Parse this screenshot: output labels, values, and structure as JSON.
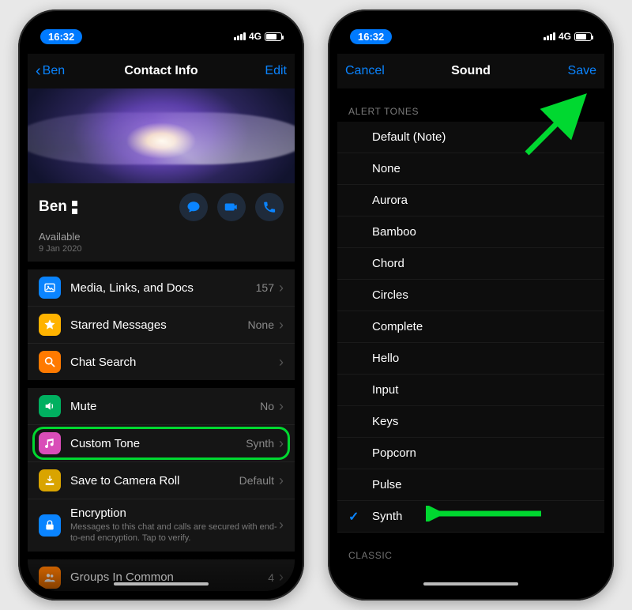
{
  "status": {
    "time": "16:32",
    "network": "4G"
  },
  "phone1": {
    "nav": {
      "back": "Ben",
      "title": "Contact Info",
      "edit": "Edit"
    },
    "contact": {
      "name": "Ben",
      "status": "Available",
      "date": "9 Jan 2020"
    },
    "group1": [
      {
        "id": "media",
        "icon": "photo-icon",
        "color": "i-blue",
        "label": "Media, Links, and Docs",
        "value": "157"
      },
      {
        "id": "starred",
        "icon": "star-icon",
        "color": "i-yellow",
        "label": "Starred Messages",
        "value": "None"
      },
      {
        "id": "search",
        "icon": "search-icon",
        "color": "i-orange",
        "label": "Chat Search",
        "value": ""
      }
    ],
    "group2": [
      {
        "id": "mute",
        "icon": "speaker-icon",
        "color": "i-green",
        "label": "Mute",
        "value": "No"
      },
      {
        "id": "tone",
        "icon": "music-icon",
        "color": "i-pink",
        "label": "Custom Tone",
        "value": "Synth",
        "highlight": true
      },
      {
        "id": "saveroll",
        "icon": "download-icon",
        "color": "i-gold",
        "label": "Save to Camera Roll",
        "value": "Default"
      },
      {
        "id": "encryption",
        "icon": "lock-icon",
        "color": "i-blue2",
        "label": "Encryption",
        "value": "",
        "sub": "Messages to this chat and calls are secured with end-to-end encryption. Tap to verify."
      }
    ],
    "group3": [
      {
        "id": "groups",
        "icon": "people-icon",
        "color": "i-orange2",
        "label": "Groups In Common",
        "value": "4"
      }
    ]
  },
  "phone2": {
    "nav": {
      "cancel": "Cancel",
      "title": "Sound",
      "save": "Save"
    },
    "sections": [
      {
        "header": "ALERT TONES",
        "items": [
          {
            "label": "Default (Note)",
            "selected": false
          },
          {
            "label": "None",
            "selected": false
          },
          {
            "label": "Aurora",
            "selected": false
          },
          {
            "label": "Bamboo",
            "selected": false
          },
          {
            "label": "Chord",
            "selected": false
          },
          {
            "label": "Circles",
            "selected": false
          },
          {
            "label": "Complete",
            "selected": false
          },
          {
            "label": "Hello",
            "selected": false
          },
          {
            "label": "Input",
            "selected": false
          },
          {
            "label": "Keys",
            "selected": false
          },
          {
            "label": "Popcorn",
            "selected": false
          },
          {
            "label": "Pulse",
            "selected": false
          },
          {
            "label": "Synth",
            "selected": true
          }
        ]
      },
      {
        "header": "CLASSIC",
        "items": []
      }
    ]
  }
}
